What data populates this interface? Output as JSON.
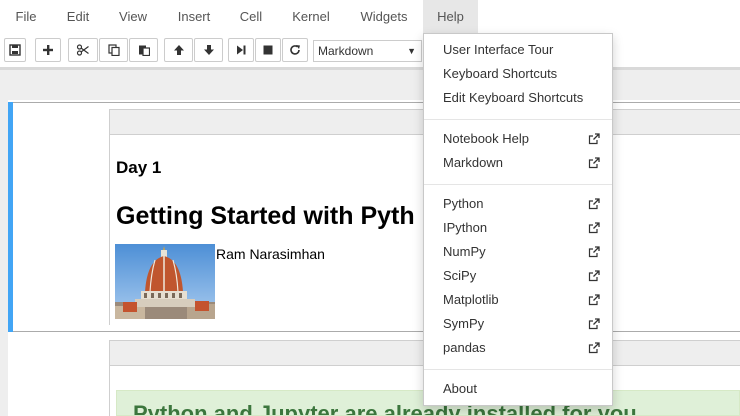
{
  "menubar": {
    "items": [
      "File",
      "Edit",
      "View",
      "Insert",
      "Cell",
      "Kernel",
      "Widgets",
      "Help"
    ],
    "active": "Help"
  },
  "toolbar": {
    "buttons": [
      "save-icon",
      "plus-icon",
      "cut-icon",
      "copy-icon",
      "paste-icon",
      "arrow-up-icon",
      "arrow-down-icon",
      "step-forward-icon",
      "stop-icon",
      "refresh-icon"
    ],
    "cell_type": "Markdown"
  },
  "notebook": {
    "day": "Day 1",
    "title": "Getting Started with Pyth",
    "author": "Ram Narasimhan",
    "alert": "Python and Jupyter are already installed for you"
  },
  "help_menu": {
    "group1": [
      "User Interface Tour",
      "Keyboard Shortcuts",
      "Edit Keyboard Shortcuts"
    ],
    "group2": [
      "Notebook Help",
      "Markdown"
    ],
    "group3": [
      "Python",
      "IPython",
      "NumPy",
      "SciPy",
      "Matplotlib",
      "SymPy",
      "pandas"
    ],
    "about": "About"
  },
  "colors": {
    "cell_selected_bar": "#42a5f5",
    "menu_active_bg": "#e7e7e7",
    "alert_bg": "#dff0d8",
    "alert_text": "#3c763d"
  }
}
